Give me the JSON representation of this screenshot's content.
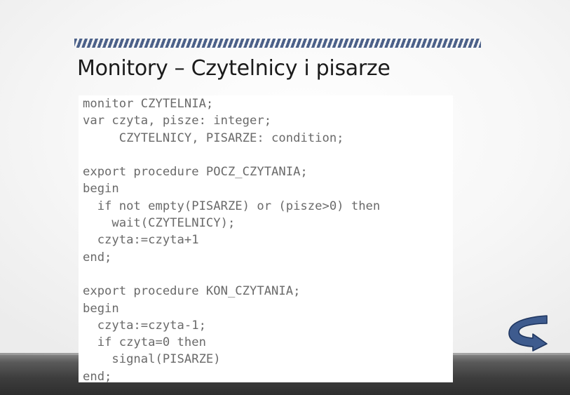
{
  "slide": {
    "title": "Monitory – Czytelnicy i pisarze",
    "code_lines": [
      "monitor CZYTELNIA;",
      "var czyta, pisze: integer;",
      "     CZYTELNICY, PISARZE: condition;",
      "",
      "export procedure POCZ_CZYTANIA;",
      "begin",
      "  if not empty(PISARZE) or (pisze>0) then",
      "    wait(CZYTELNICY);",
      "  czyta:=czyta+1",
      "end;",
      "",
      "export procedure KON_CZYTANIA;",
      "begin",
      "  czyta:=czyta-1;",
      "  if czyta=0 then",
      "    signal(PISARZE)",
      "end;"
    ]
  },
  "navigation": {
    "return_icon": "curved-return-arrow-icon"
  },
  "colors": {
    "accent": "#4c6189",
    "arrow_fill": "#3e5b8e",
    "arrow_stroke": "#1f3660",
    "code_text": "#6a6a6a",
    "title_text": "#1b1b1b"
  }
}
